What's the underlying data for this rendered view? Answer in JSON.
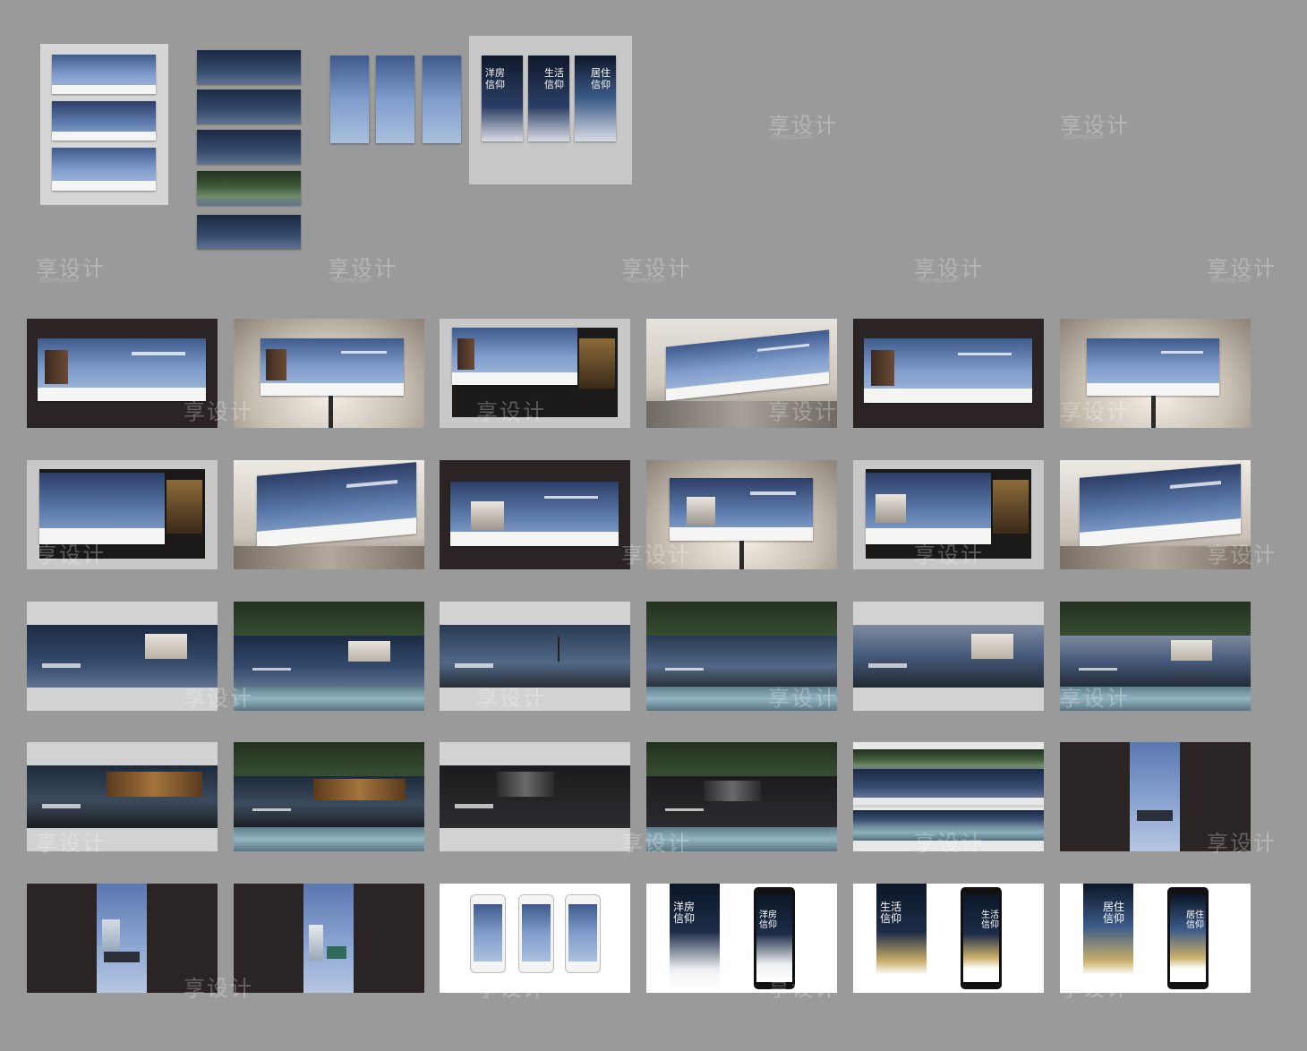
{
  "watermark": {
    "text": "享设计",
    "sub": "hsjdesign.com"
  },
  "posters": [
    {
      "title": "洋房\n信仰"
    },
    {
      "title": "生活\n信仰"
    },
    {
      "title": "居住\n信仰"
    }
  ],
  "phones": [
    {
      "title": "洋房\n信仰"
    },
    {
      "title": "生活\n信仰"
    },
    {
      "title": "居住\n信仰"
    }
  ],
  "colors": {
    "background": "#9a9a9a",
    "dark_panel": "#2a2524",
    "light_panel": "#c8c8c8",
    "accent_blue": "#7f9ccc"
  }
}
